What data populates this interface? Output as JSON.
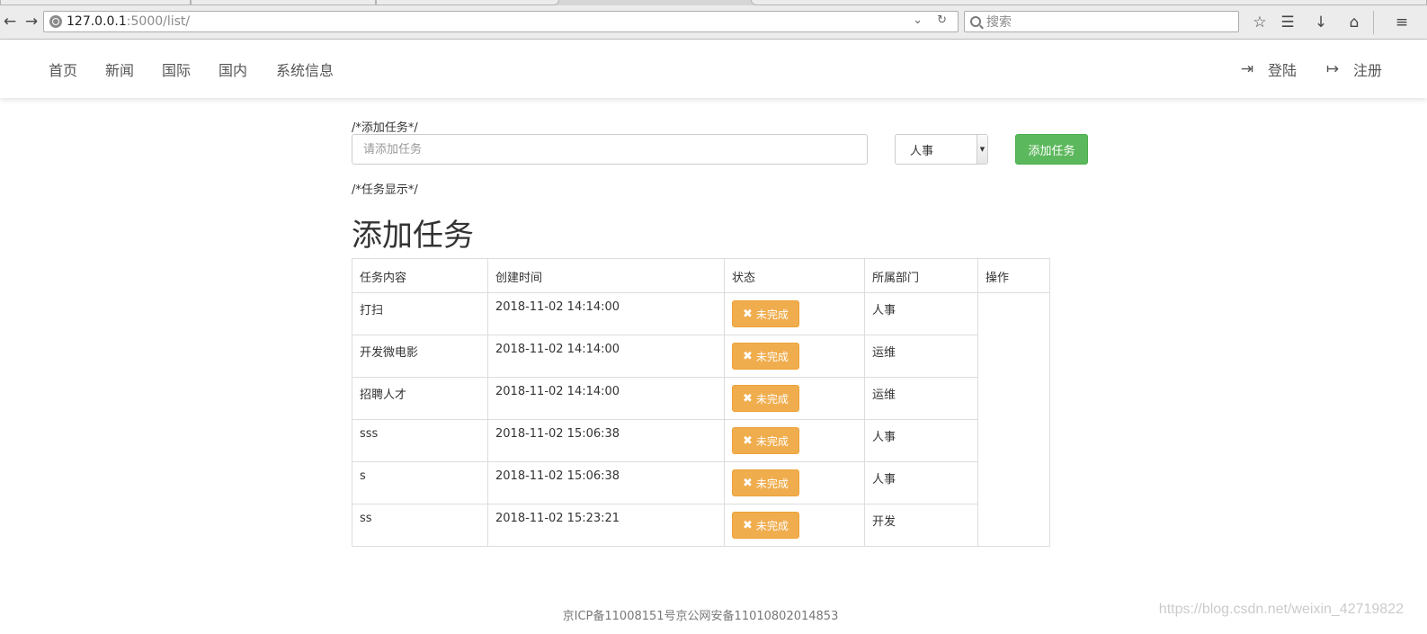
{
  "browser": {
    "url_host": "127.0.0.1",
    "url_path": ":5000/list/",
    "search_placeholder": "搜索"
  },
  "navbar": {
    "links": [
      "首页",
      "新闻",
      "国际",
      "国内",
      "系统信息"
    ],
    "login": "登陆",
    "register": "注册"
  },
  "form": {
    "comment": "/*添加任务*/",
    "input_placeholder": "请添加任务",
    "department_selected": "人事",
    "add_button": "添加任务"
  },
  "display": {
    "comment": "/*任务显示*/",
    "heading": "添加任务"
  },
  "table": {
    "headers": [
      "任务内容",
      "创建时间",
      "状态",
      "所属部门",
      "操作"
    ],
    "rows": [
      {
        "content": "打扫",
        "created": "2018-11-02 14:14:00",
        "status": "未完成",
        "dept": "人事"
      },
      {
        "content": "开发微电影",
        "created": "2018-11-02 14:14:00",
        "status": "未完成",
        "dept": "运维"
      },
      {
        "content": "招聘人才",
        "created": "2018-11-02 14:14:00",
        "status": "未完成",
        "dept": "运维"
      },
      {
        "content": "sss",
        "created": "2018-11-02 15:06:38",
        "status": "未完成",
        "dept": "人事"
      },
      {
        "content": "s",
        "created": "2018-11-02 15:06:38",
        "status": "未完成",
        "dept": "人事"
      },
      {
        "content": "ss",
        "created": "2018-11-02 15:23:21",
        "status": "未完成",
        "dept": "开发"
      }
    ]
  },
  "footer": "京ICP备11008151号京公网安备11010802014853",
  "watermark": "https://blog.csdn.net/weixin_42719822",
  "colors": {
    "success": "#5cb85c",
    "warning": "#f0ad4e"
  }
}
